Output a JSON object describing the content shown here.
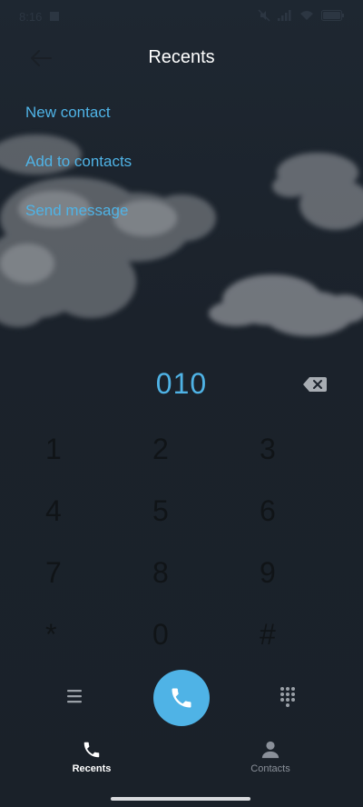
{
  "status_bar": {
    "time": "8:16",
    "icons": [
      "mute-icon",
      "signal-icon",
      "wifi-icon",
      "battery-icon"
    ]
  },
  "header": {
    "title": "Recents",
    "back_icon": "back-arrow-icon"
  },
  "menu": {
    "items": [
      {
        "label": "New contact"
      },
      {
        "label": "Add to contacts"
      },
      {
        "label": "Send message"
      }
    ]
  },
  "dialer": {
    "number": "010",
    "backspace_icon": "backspace-icon",
    "keys": [
      {
        "digit": "1",
        "letters": ""
      },
      {
        "digit": "2",
        "letters": ""
      },
      {
        "digit": "3",
        "letters": ""
      },
      {
        "digit": "4",
        "letters": ""
      },
      {
        "digit": "5",
        "letters": ""
      },
      {
        "digit": "6",
        "letters": ""
      },
      {
        "digit": "7",
        "letters": ""
      },
      {
        "digit": "8",
        "letters": ""
      },
      {
        "digit": "9",
        "letters": ""
      },
      {
        "digit": "*",
        "letters": ""
      },
      {
        "digit": "0",
        "letters": ""
      },
      {
        "digit": "#",
        "letters": ""
      }
    ]
  },
  "actions": {
    "menu_icon": "menu-lines-icon",
    "call_icon": "phone-icon",
    "dialpad_icon": "dialpad-icon"
  },
  "bottom_nav": {
    "items": [
      {
        "label": "Recents",
        "icon": "phone-icon",
        "active": true
      },
      {
        "label": "Contacts",
        "icon": "person-icon",
        "active": false
      }
    ]
  },
  "colors": {
    "accent": "#4fb3e6",
    "background": "#1c232c",
    "inactive_text": "#8a9099"
  }
}
